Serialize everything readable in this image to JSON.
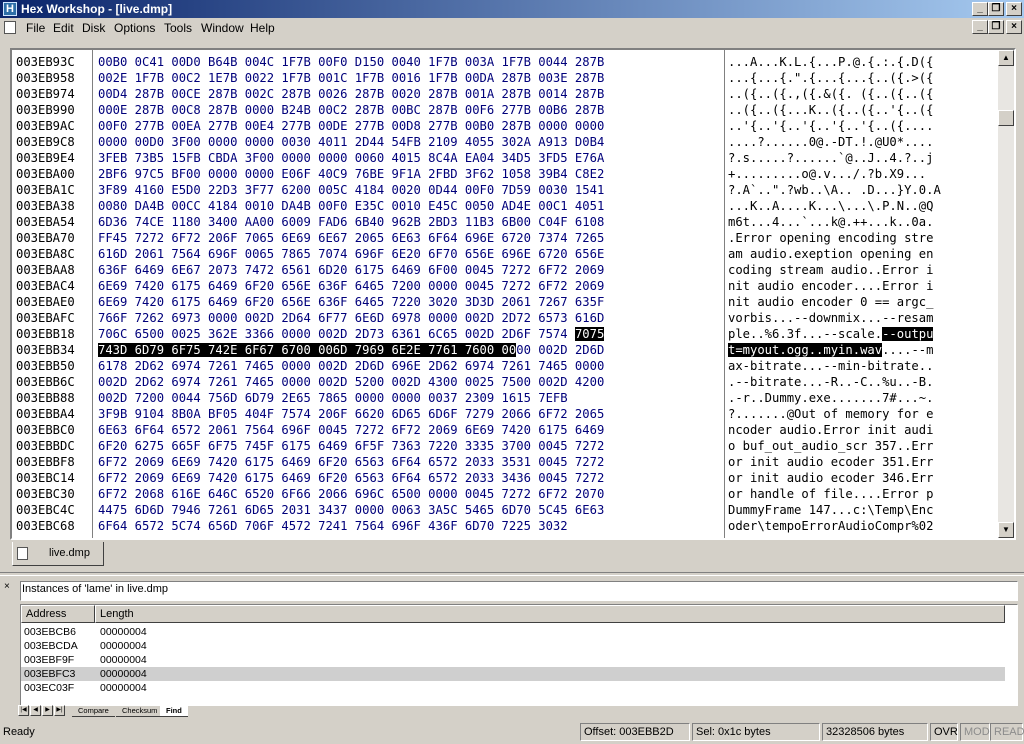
{
  "window": {
    "title": "Hex Workshop - [live.dmp]"
  },
  "menu": [
    "File",
    "Edit",
    "Disk",
    "Options",
    "Tools",
    "Window",
    "Help"
  ],
  "hex_rows": [
    {
      "addr": "003EB93C",
      "hex": "00B0 0C41 00D0 B64B 004C 1F7B 00F0 D150 0040 1F7B 003A 1F7B 0044 287B",
      "ascii": "...A...K.L.{...P.@.{.:.{.D({"
    },
    {
      "addr": "003EB958",
      "hex": "002E 1F7B 00C2 1E7B 0022 1F7B 001C 1F7B 0016 1F7B 00DA 287B 003E 287B",
      "ascii": "...{...{.\".{...{...{..({.>({"
    },
    {
      "addr": "003EB974",
      "hex": "00D4 287B 00CE 287B 002C 287B 0026 287B 0020 287B 001A 287B 0014 287B",
      "ascii": "..({..({.,({.&({. ({..({..({"
    },
    {
      "addr": "003EB990",
      "hex": "000E 287B 00C8 287B 0000 B24B 00C2 287B 00BC 287B 00F6 277B 00B6 287B",
      "ascii": "..({..({...K..({..({..'{..({"
    },
    {
      "addr": "003EB9AC",
      "hex": "00F0 277B 00EA 277B 00E4 277B 00DE 277B 00D8 277B 00B0 287B 0000 0000",
      "ascii": "..'{..'{..'{..'{..'{..({...."
    },
    {
      "addr": "003EB9C8",
      "hex": "0000 00D0 3F00 0000 0000 0030 4011 2D44 54FB 2109 4055 302A A913 D0B4",
      "ascii": "....?......0@.-DT.!.@U0*...."
    },
    {
      "addr": "003EB9E4",
      "hex": "3FEB 73B5 15FB CBDA 3F00 0000 0000 0060 4015 8C4A EA04 34D5 3FD5 E76A",
      "ascii": "?.s.....?......`@..J..4.?..j"
    },
    {
      "addr": "003EBA00",
      "hex": "2BF6 97C5 BF00 0000 0000 E06F 40C9 76BE 9F1A 2FBD 3F62 1058 39B4 C8E2",
      "ascii": "+.........o@.v.../.?b.X9..."
    },
    {
      "addr": "003EBA1C",
      "hex": "3F89 4160 E5D0 22D3 3F77 6200 005C 4184 0020 0D44 00F0 7D59 0030 1541",
      "ascii": "?.A`..\".?wb..\\A.. .D...}Y.0.A"
    },
    {
      "addr": "003EBA38",
      "hex": "0080 DA4B 00CC 4184 0010 DA4B 00F0 E35C 0010 E45C 0050 AD4E 00C1 4051",
      "ascii": "...K..A....K...\\...\\.P.N..@Q"
    },
    {
      "addr": "003EBA54",
      "hex": "6D36 74CE 1180 3400 AA00 6009 FAD6 6B40 962B 2BD3 11B3 6B00 C04F 6108",
      "ascii": "m6t...4...`...k@.++...k..0a."
    },
    {
      "addr": "003EBA70",
      "hex": "FF45 7272 6F72 206F 7065 6E69 6E67 2065 6E63 6F64 696E 6720 7374 7265",
      "ascii": ".Error opening encoding stre"
    },
    {
      "addr": "003EBA8C",
      "hex": "616D 2061 7564 696F 0065 7865 7074 696F 6E20 6F70 656E 696E 6720 656E",
      "ascii": "am audio.exeption opening en"
    },
    {
      "addr": "003EBAA8",
      "hex": "636F 6469 6E67 2073 7472 6561 6D20 6175 6469 6F00 0045 7272 6F72 2069",
      "ascii": "coding stream audio..Error i"
    },
    {
      "addr": "003EBAC4",
      "hex": "6E69 7420 6175 6469 6F20 656E 636F 6465 7200 0000 0045 7272 6F72 2069",
      "ascii": "nit audio encoder....Error i"
    },
    {
      "addr": "003EBAE0",
      "hex": "6E69 7420 6175 6469 6F20 656E 636F 6465 7220 3020 3D3D 2061 7267 635F",
      "ascii": "nit audio encoder 0 == argc_"
    },
    {
      "addr": "003EBAFC",
      "hex": "766F 7262 6973 0000 002D 2D64 6F77 6E6D 6978 0000 002D 2D72 6573 616D",
      "ascii": "vorbis...--downmix...--resam"
    },
    {
      "addr": "003EBB18",
      "hex": "706C 6500 0025 362E 3366 0000 002D 2D73 6361 6C65 002D 2D6F 7574 7075",
      "ascii": "ple..%6.3f...--scale.--outpu"
    },
    {
      "addr": "003EBB34",
      "hex": "743D 6D79 6F75 742E 6F67 6700 006D 7969 6E2E 7761 7600 0000 002D 2D6D",
      "ascii": "t=myout.ogg..myin.wav....--m"
    },
    {
      "addr": "003EBB50",
      "hex": "6178 2D62 6974 7261 7465 0000 002D 2D6D 696E 2D62 6974 7261 7465 0000",
      "ascii": "ax-bitrate...--min-bitrate.."
    },
    {
      "addr": "003EBB6C",
      "hex": "002D 2D62 6974 7261 7465 0000 002D 5200 002D 4300 0025 7500 002D 4200",
      "ascii": ".--bitrate...-R..-C..%u..-B."
    },
    {
      "addr": "003EBB88",
      "hex": "002D 7200 0044 756D 6D79 2E65 7865 0000 0000 0037 2309 1615 7EFB",
      "ascii": ".-r..Dummy.exe.......7#...~."
    },
    {
      "addr": "003EBBA4",
      "hex": "3F9B 9104 8B0A BF05 404F 7574 206F 6620 6D65 6D6F 7279 2066 6F72 2065",
      "ascii": "?.......@Out of memory for e"
    },
    {
      "addr": "003EBBC0",
      "hex": "6E63 6F64 6572 2061 7564 696F 0045 7272 6F72 2069 6E69 7420 6175 6469",
      "ascii": "ncoder audio.Error init audi"
    },
    {
      "addr": "003EBBDC",
      "hex": "6F20 6275 665F 6F75 745F 6175 6469 6F5F 7363 7220 3335 3700 0045 7272",
      "ascii": "o buf_out_audio_scr 357..Err"
    },
    {
      "addr": "003EBBF8",
      "hex": "6F72 2069 6E69 7420 6175 6469 6F20 6563 6F64 6572 2033 3531 0045 7272",
      "ascii": "or init audio ecoder 351.Err"
    },
    {
      "addr": "003EBC14",
      "hex": "6F72 2069 6E69 7420 6175 6469 6F20 6563 6F64 6572 2033 3436 0045 7272",
      "ascii": "or init audio ecoder 346.Err"
    },
    {
      "addr": "003EBC30",
      "hex": "6F72 2068 616E 646C 6520 6F66 2066 696C 6500 0000 0045 7272 6F72 2070",
      "ascii": "or handle of file....Error p"
    },
    {
      "addr": "003EBC4C",
      "hex": "4475 6D6D 7946 7261 6D65 2031 3437 0000 0063 3A5C 5465 6D70 5C45 6E63",
      "ascii": "DummyFrame 147...c:\\Temp\\Enc"
    },
    {
      "addr": "003EBC68",
      "hex": "6F64 6572 5C74 656D 706F 4572 7241 7564 696F 436F 6D70 7225 3032",
      "ascii": "oder\\tempoErrorAudioCompr%02"
    }
  ],
  "document_tab": "live.dmp",
  "find_panel": {
    "title": "Instances of 'lame' in live.dmp",
    "columns": [
      "Address",
      "Length"
    ],
    "rows": [
      {
        "address": "003EBCB6",
        "length": "00000004"
      },
      {
        "address": "003EBCDA",
        "length": "00000004"
      },
      {
        "address": "003EBF9F",
        "length": "00000004"
      },
      {
        "address": "003EBFC3",
        "length": "00000004"
      },
      {
        "address": "003EC03F",
        "length": "00000004"
      }
    ],
    "tabs": [
      "Compare",
      "Checksum",
      "Find"
    ]
  },
  "status": {
    "ready": "Ready",
    "offset": "Offset: 003EBB2D",
    "selection": "Sel: 0x1c bytes",
    "size": "32328506 bytes",
    "ovr": "OVR",
    "mod": "MOD",
    "read": "READ"
  }
}
